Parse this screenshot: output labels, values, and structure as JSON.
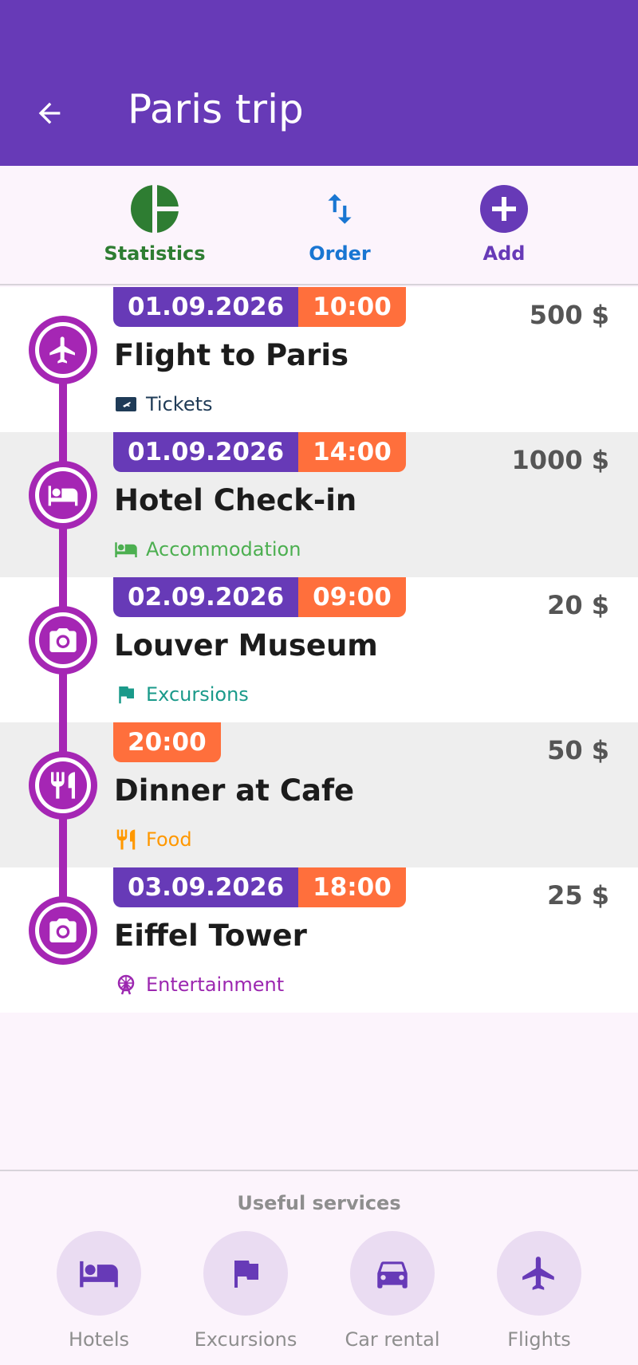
{
  "appbar": {
    "title": "Paris trip",
    "back_icon": "arrow-back-icon",
    "color": "#673ab7"
  },
  "toolbar": {
    "statistics": {
      "label": "Statistics",
      "icon": "pie-chart-icon",
      "color": "#2e7d32"
    },
    "order": {
      "label": "Order",
      "icon": "swap-vertical-icon",
      "color": "#1976d2"
    },
    "add": {
      "label": "Add",
      "icon": "add-circle-icon",
      "color": "#673ab7"
    }
  },
  "events": [
    {
      "date": "01.09.2026",
      "time": "10:00",
      "title": "Flight to Paris",
      "category": "Tickets",
      "category_icon": "ticket-icon",
      "category_color": "#1f3b57",
      "amount": "500 $",
      "node_icon": "airplane-icon"
    },
    {
      "date": "01.09.2026",
      "time": "14:00",
      "title": "Hotel Check-in",
      "category": "Accommodation",
      "category_icon": "bed-icon",
      "category_color": "#4caf50",
      "amount": "1000 $",
      "node_icon": "bed-icon"
    },
    {
      "date": "02.09.2026",
      "time": "09:00",
      "title": "Louver Museum",
      "category": "Excursions",
      "category_icon": "flag-icon",
      "category_color": "#1a9a8a",
      "amount": "20 $",
      "node_icon": "camera-icon"
    },
    {
      "date": "",
      "time": "20:00",
      "title": "Dinner at Cafe",
      "category": "Food",
      "category_icon": "cutlery-icon",
      "category_color": "#ff9800",
      "amount": "50 $",
      "node_icon": "cutlery-icon"
    },
    {
      "date": "03.09.2026",
      "time": "18:00",
      "title": "Eiffel Tower",
      "category": "Entertainment",
      "category_icon": "ferris-wheel-icon",
      "category_color": "#9c27b0",
      "amount": "25 $",
      "node_icon": "camera-icon"
    }
  ],
  "colors": {
    "date_badge": "#673ab7",
    "time_badge": "#ff6f3c",
    "timeline": "#a526b4"
  },
  "services": {
    "title": "Useful services",
    "items": [
      {
        "label": "Hotels",
        "icon": "bed-icon"
      },
      {
        "label": "Excursions",
        "icon": "flag-icon"
      },
      {
        "label": "Car rental",
        "icon": "car-icon"
      },
      {
        "label": "Flights",
        "icon": "airplane-icon"
      }
    ]
  }
}
